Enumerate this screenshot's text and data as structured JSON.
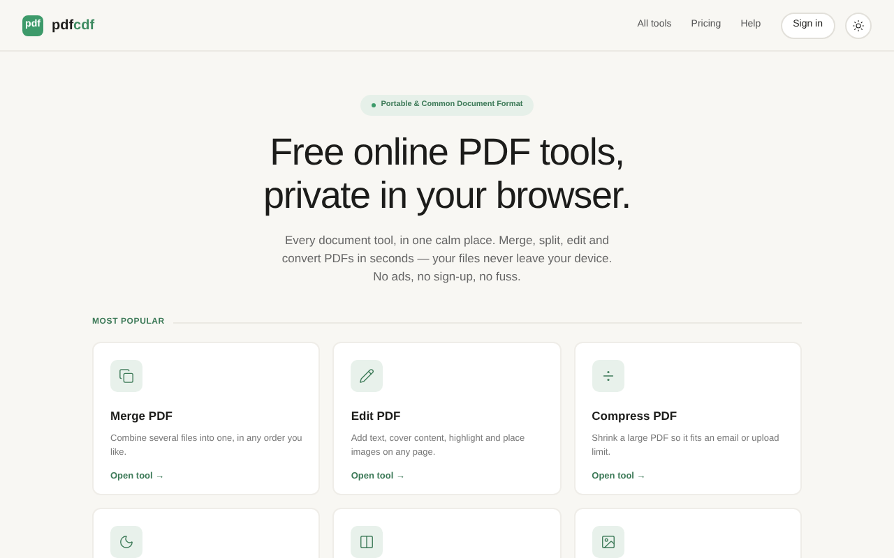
{
  "header": {
    "logo_mark": "pdf",
    "brand": "pdf",
    "brand_accent": "cdf",
    "nav": [
      "All tools",
      "Pricing",
      "Help"
    ],
    "sign_in": "Sign in"
  },
  "hero": {
    "badge": "Portable & Common Document Format",
    "title_lines": [
      "Free online PDF tools,",
      "private in your browser."
    ],
    "lines": [
      "Every document tool, in one calm place. Merge, split, edit and",
      "convert PDFs in seconds — your files never leave your device.",
      "No ads, no sign-up, no fuss."
    ]
  },
  "section": {
    "title": "MOST POPULAR"
  },
  "tools": [
    {
      "kind": "full",
      "title": "Merge PDF",
      "description": "Combine several files into one, in any order you like.",
      "link": "Open tool →"
    },
    {
      "kind": "full",
      "title": "Edit PDF",
      "description": "Add text, cover content, highlight and place images on any page.",
      "link": "Open tool →"
    },
    {
      "kind": "full",
      "title": "Compress PDF",
      "description": "Shrink a large PDF so it fits an email or upload limit.",
      "link": "Open tool →"
    },
    {
      "kind": "cut"
    },
    {
      "kind": "cut"
    },
    {
      "kind": "cut"
    }
  ]
}
